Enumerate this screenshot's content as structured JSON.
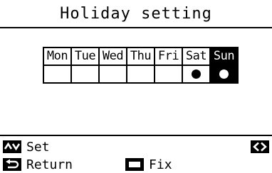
{
  "title": "Holiday setting",
  "days": [
    "Mon",
    "Tue",
    "Wed",
    "Thu",
    "Fri",
    "Sat",
    "Sun"
  ],
  "holidays": [
    false,
    false,
    false,
    false,
    false,
    true,
    true
  ],
  "selected_day_index": 6,
  "footer": {
    "set_label": "Set",
    "return_label": "Return",
    "fix_label": "Fix"
  },
  "icons": {
    "up_down": "up-down-arrows-icon",
    "left_right": "left-right-arrows-icon",
    "return": "return-arrow-icon",
    "fix": "rectangle-button-icon"
  }
}
